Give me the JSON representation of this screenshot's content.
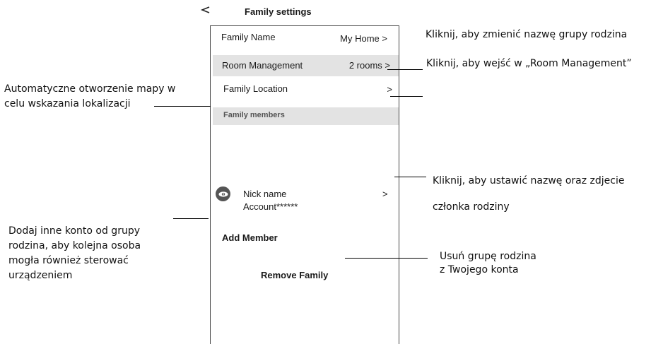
{
  "header": {
    "back_icon": "back-arrow-icon",
    "title": "Family settings"
  },
  "rows": {
    "family_name": {
      "label": "Family Name",
      "value": "My Home >"
    },
    "room_management": {
      "label": "Room Management",
      "value": "2 rooms >"
    },
    "family_location": {
      "label": "Family Location",
      "value": ">"
    }
  },
  "members_section": {
    "header": "Family members",
    "member": {
      "avatar_icon": "user-avatar-icon",
      "nick_name": "Nick name",
      "account": "Account******",
      "chevron": ">"
    }
  },
  "actions": {
    "add_member": "Add Member",
    "remove_family": "Remove Family"
  },
  "annotations": {
    "family_name_note": "Kliknij, aby zmienić nazwę grupy rodzina",
    "room_management_note": "Kliknij, aby wejść w „Room Management”",
    "location_note_line1": "Automatyczne otworzenie mapy w",
    "location_note_line2": "celu wskazania lokalizacji",
    "member_note_line1": "Kliknij, aby ustawić nazwę oraz zdjecie",
    "member_note_line2": "członka rodziny",
    "add_member_note_line1": "Dodaj inne konto od grupy",
    "add_member_note_line2": "rodzina, aby kolejna osoba",
    "add_member_note_line3": "mogła również sterować",
    "add_member_note_line4": "urządzeniem",
    "remove_note_line1": "Usuń grupę rodzina",
    "remove_note_line2": "z Twojego konta"
  }
}
